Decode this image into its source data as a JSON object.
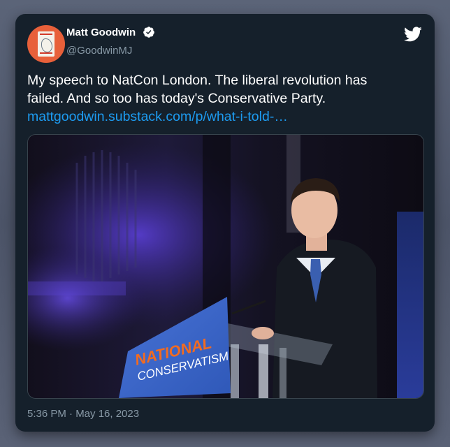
{
  "tweet": {
    "author_name": "Matt Goodwin",
    "author_handle": "@GoodwinMJ",
    "text_lines": [
      "My speech to NatCon London. The liberal revolution has",
      "failed. And so too has today's Conservative Party."
    ],
    "link_text": "mattgoodwin.substack.com/p/what-i-told-…",
    "timestamp": "5:36 PM · May 16, 2023",
    "icons": [
      "verified-badge-icon",
      "twitter-bird-icon"
    ],
    "colors": {
      "card": "#15202b",
      "link": "#1d9bf0",
      "muted": "#8899a6",
      "podium": "#3b67c8",
      "podium_text": "#f26b21"
    }
  },
  "media": {
    "podium_line1": "NATIONAL",
    "podium_line2": "CONSERVATISM"
  }
}
